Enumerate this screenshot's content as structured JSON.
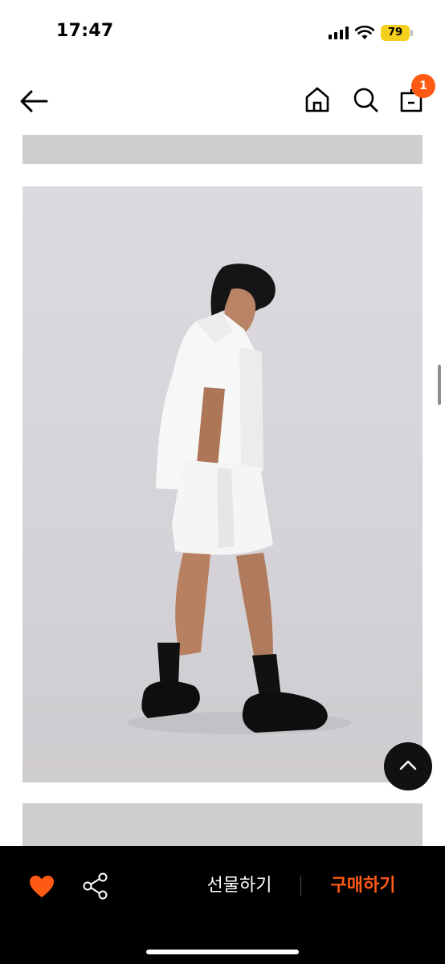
{
  "status_bar": {
    "time": "17:47",
    "battery": "79"
  },
  "nav": {
    "cart_count": "1",
    "icons": [
      "arrow-left-icon",
      "home-icon",
      "search-icon",
      "shopping-bag-icon"
    ]
  },
  "bottom_bar": {
    "gift_label": "선물하기",
    "buy_label": "구매하기",
    "accent_color": "#ff5a14"
  },
  "colors": {
    "badge": "#ff5a14",
    "battery": "#f4cf1c",
    "bottom_bar": "#000000"
  }
}
